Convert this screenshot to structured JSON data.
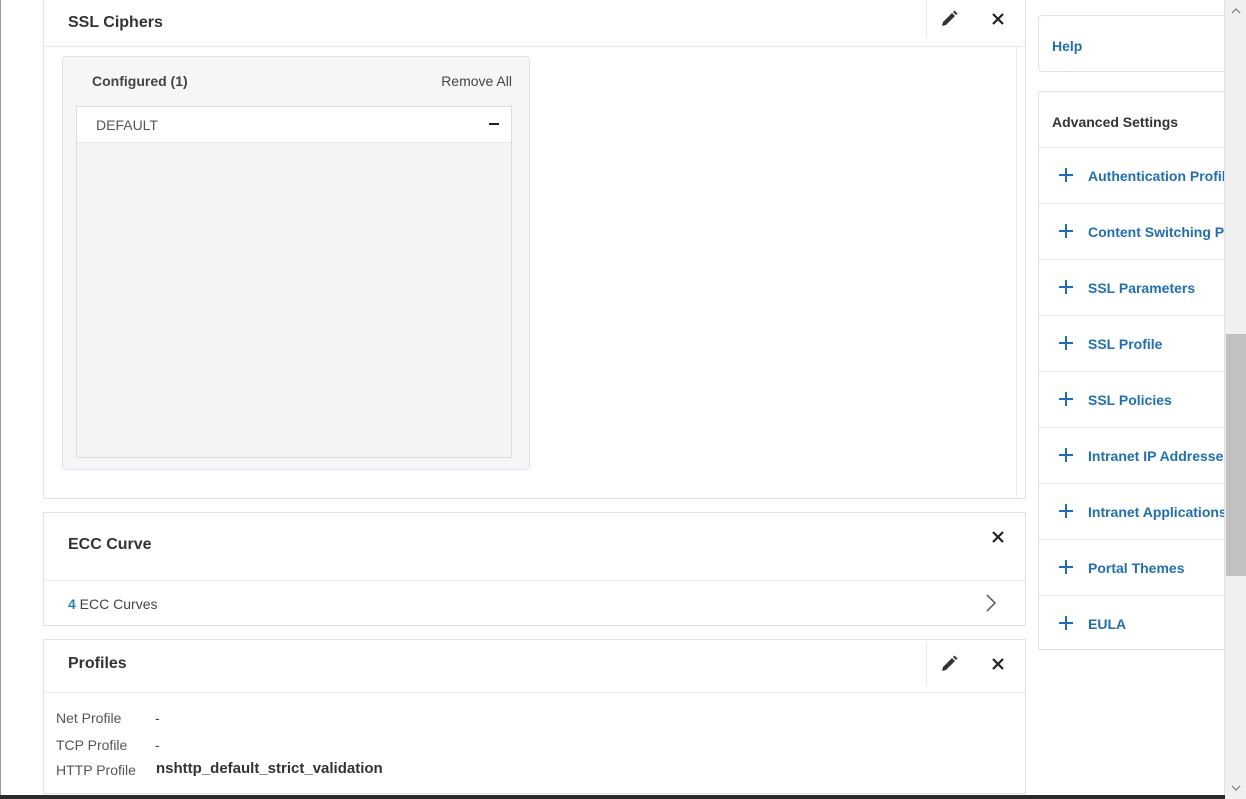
{
  "ssl_ciphers": {
    "title": "SSL Ciphers",
    "edit_icon": "pencil-icon",
    "close_icon": "close-icon",
    "configured_label": "Configured (1)",
    "remove_all_label": "Remove All",
    "ciphers": [
      {
        "name": "DEFAULT"
      }
    ]
  },
  "ecc_curve": {
    "title": "ECC Curve",
    "count": "4",
    "count_label": " ECC Curves",
    "chevron_icon": "chevron-right-icon"
  },
  "profiles": {
    "title": "Profiles",
    "rows": [
      {
        "label": "Net Profile",
        "value": "-"
      },
      {
        "label": "TCP Profile",
        "value": "-"
      },
      {
        "label": "HTTP Profile",
        "value": "nshttp_default_strict_validation"
      }
    ]
  },
  "sidebar": {
    "help_label": "Help",
    "advanced_title": "Advanced Settings",
    "items": [
      {
        "label": "Authentication Profile"
      },
      {
        "label": "Content Switching Policies"
      },
      {
        "label": "SSL Parameters"
      },
      {
        "label": "SSL Profile"
      },
      {
        "label": "SSL Policies"
      },
      {
        "label": "Intranet IP Addresses"
      },
      {
        "label": "Intranet Applications"
      },
      {
        "label": "Portal Themes"
      },
      {
        "label": "EULA"
      }
    ]
  },
  "colors": {
    "link": "#1f6fb6",
    "count_accent": "#2a7fc4",
    "border": "#dfe3e8"
  }
}
